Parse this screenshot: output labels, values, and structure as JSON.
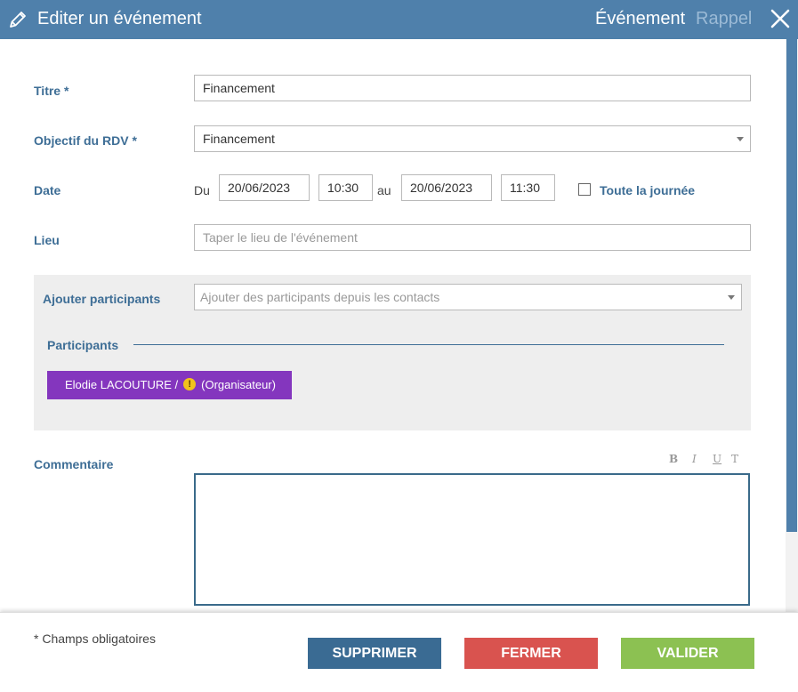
{
  "header": {
    "title": "Editer un événement",
    "tab_event": "Événement",
    "tab_rappel": "Rappel"
  },
  "form": {
    "titre": {
      "label": "Titre *",
      "value": "Financement"
    },
    "objectif": {
      "label": "Objectif du RDV *",
      "value": "Financement"
    },
    "date": {
      "label": "Date",
      "du": "Du",
      "start_date": "20/06/2023",
      "start_time": "10:30",
      "au": "au",
      "end_date": "20/06/2023",
      "end_time": "11:30",
      "all_day_label": "Toute la journée",
      "all_day_checked": false
    },
    "lieu": {
      "label": "Lieu",
      "placeholder": "Taper le lieu de l'événement"
    },
    "ajouter_participants": {
      "label": "Ajouter participants",
      "placeholder": "Ajouter des participants depuis les contacts"
    },
    "participants": {
      "label": "Participants",
      "items": [
        {
          "name": "Elodie LACOUTURE /",
          "warning": "!",
          "role": "(Organisateur)"
        }
      ]
    },
    "commentaire": {
      "label": "Commentaire",
      "toolbar": {
        "bold": "B",
        "italic": "I",
        "underline": "U",
        "clear": "T"
      }
    }
  },
  "footer": {
    "required_note": "* Champs obligatoires",
    "delete_label": "SUPPRIMER",
    "close_label": "FERMER",
    "validate_label": "VALIDER"
  },
  "colors": {
    "header": "#4f80ab",
    "label": "#3e6e96",
    "chip": "#8436be",
    "delete": "#3a6b93",
    "close": "#d9534f",
    "validate": "#8cc152"
  }
}
